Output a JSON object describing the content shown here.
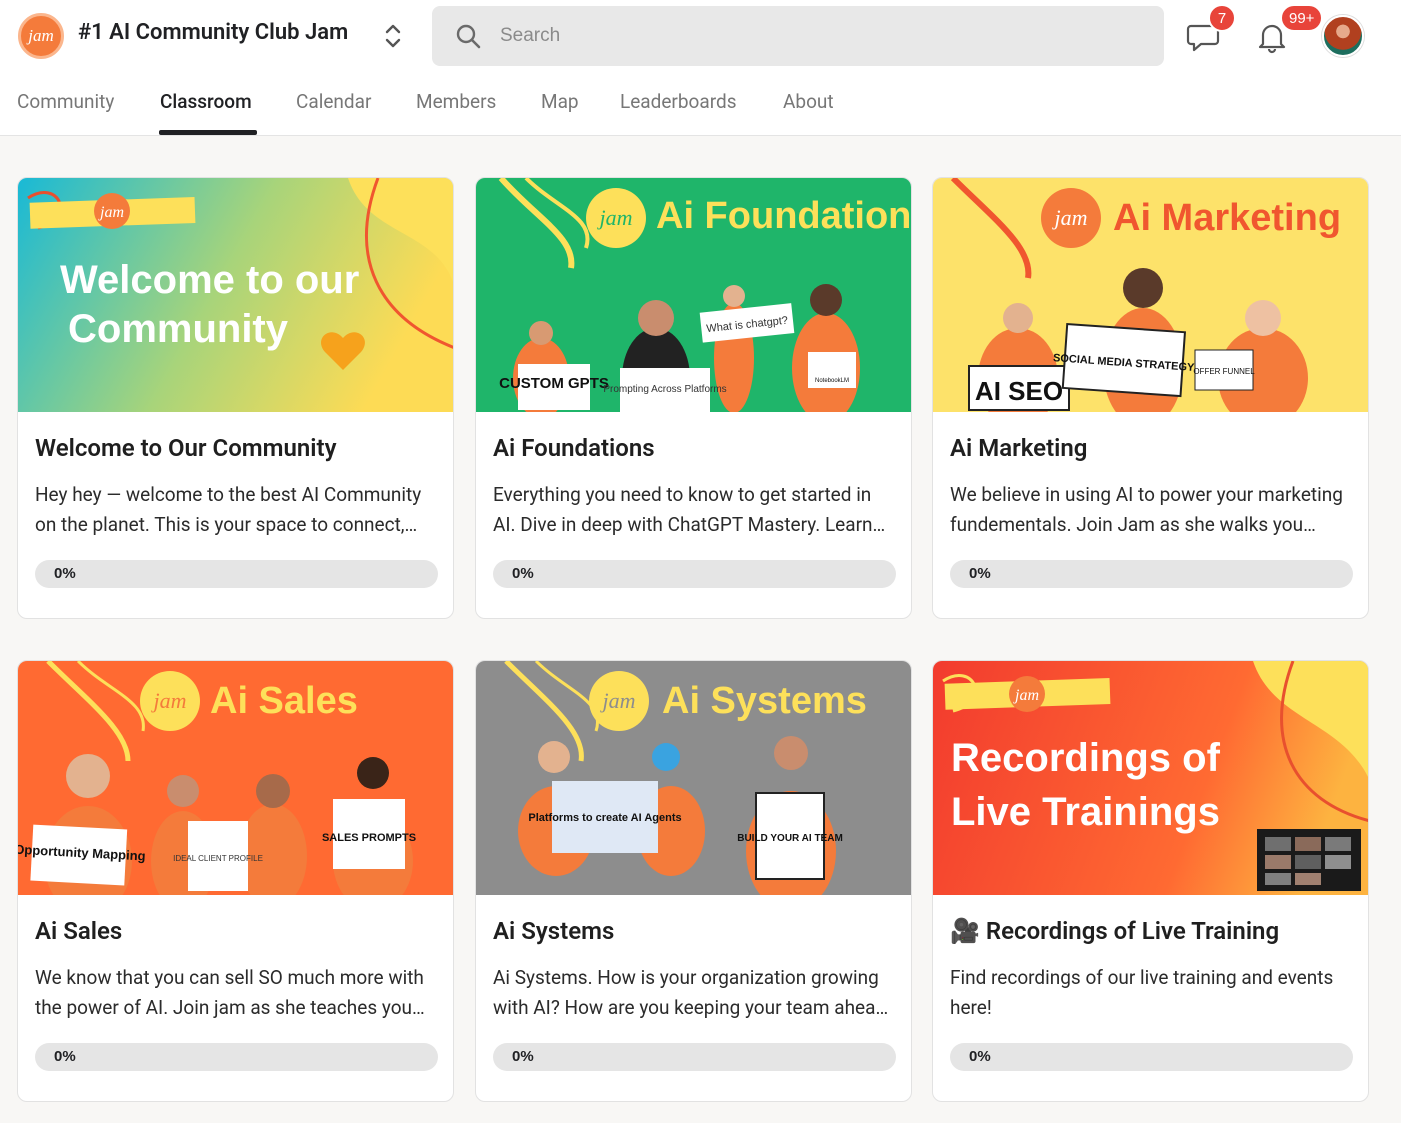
{
  "header": {
    "logo_text": "jam",
    "group_title": "#1 AI Community Club Jam",
    "search_placeholder": "Search",
    "chat_badge": "7",
    "notification_badge": "99+"
  },
  "nav": {
    "tabs": [
      {
        "label": "Community"
      },
      {
        "label": "Classroom"
      },
      {
        "label": "Calendar"
      },
      {
        "label": "Members"
      },
      {
        "label": "Map"
      },
      {
        "label": "Leaderboards"
      },
      {
        "label": "About"
      }
    ],
    "active": "Classroom"
  },
  "colors": {
    "brand_orange": "#f47b3b",
    "badge_red": "#e8443a",
    "foundations_green": "#1fb56a",
    "marketing_yellow": "#fde26a",
    "sales_orange": "#ff6a32",
    "systems_gray": "#8d8d8d",
    "recordings_red": "#f23b2e"
  },
  "courses": [
    {
      "title": "Welcome to Our Community",
      "description": "Hey hey — welcome to the best AI Community on the planet. This is your space to connect, learn and grow with fellow creators.",
      "progress": 0,
      "progress_label": "0%",
      "banner": {
        "logo": "jam",
        "line1": "Welcome to our",
        "line2": "Community"
      }
    },
    {
      "title": "Ai Foundations",
      "description": "Everything you need to know to get started in AI. Dive in deep with ChatGPT Mastery. Learn the platforms and prompting.",
      "progress": 0,
      "progress_label": "0%",
      "banner": {
        "logo": "jam",
        "heading": "Ai Foundations",
        "sign1": "CUSTOM GPTS",
        "sign2": "Prompting Across Platforms",
        "sign3": "What is chatgpt?",
        "sign4": "NotebookLM"
      }
    },
    {
      "title": "Ai Marketing",
      "description": "We believe in using AI to power your marketing fundementals. Join Jam as she walks you through it all.",
      "progress": 0,
      "progress_label": "0%",
      "banner": {
        "logo": "jam",
        "heading": "Ai Marketing",
        "sign1": "AI SEO",
        "sign2": "SOCIAL MEDIA STRATEGY",
        "sign3": "OFFER FUNNEL"
      }
    },
    {
      "title": "Ai Sales",
      "description": "We know that you can sell SO much more with the power of AI. Join jam as she teaches you how to sell smarter.",
      "progress": 0,
      "progress_label": "0%",
      "banner": {
        "logo": "jam",
        "heading": "Ai Sales",
        "sign1": "Opportunity Mapping",
        "sign2": "IDEAL CLIENT PROFILE",
        "sign3": "SALES PROMPTS"
      }
    },
    {
      "title": "Ai Systems",
      "description": "Ai Systems. How is your organization growing with AI? How are you keeping your team ahead of the curve?",
      "progress": 0,
      "progress_label": "0%",
      "banner": {
        "logo": "jam",
        "heading": "Ai Systems",
        "sign1": "Platforms to create AI Agents",
        "sign2": "BUILD YOUR AI TEAM"
      }
    },
    {
      "title": "Recordings of Live Training",
      "title_icon": "🎥",
      "description": "Find recordings of our live training and events here!",
      "progress": 0,
      "progress_label": "0%",
      "banner": {
        "logo": "jam",
        "line1": "Recordings of",
        "line2": "Live Trainings"
      }
    }
  ]
}
